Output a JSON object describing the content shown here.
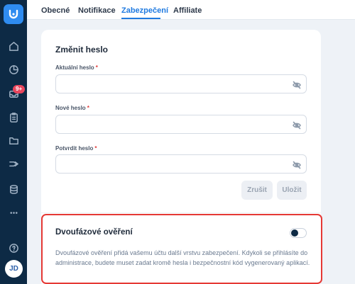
{
  "tabs": [
    {
      "label": "Obecné"
    },
    {
      "label": "Notifikace"
    },
    {
      "label": "Zabezpečení"
    },
    {
      "label": "Affiliate"
    }
  ],
  "active_tab": "Zabezpečení",
  "sidebar": {
    "badge": "9+",
    "avatar_initials": "JD",
    "icons": [
      "home-icon",
      "chart-icon",
      "inbox-icon",
      "clipboard-icon",
      "folder-icon",
      "flow-icon",
      "database-icon",
      "more-icon",
      "help-icon"
    ]
  },
  "password_form": {
    "title": "Změnit heslo",
    "fields": [
      {
        "label": "Aktuální heslo",
        "required": "*",
        "value": ""
      },
      {
        "label": "Nové heslo",
        "required": "*",
        "value": ""
      },
      {
        "label": "Potvrdit heslo",
        "required": "*",
        "value": ""
      }
    ],
    "cancel_label": "Zrušit",
    "save_label": "Uložit"
  },
  "two_factor": {
    "title": "Dvoufázové ověření",
    "enabled": false,
    "description": "Dvoufázové ověření přidá vašemu účtu další vrstvu zabezpečení. Kdykoli se přihlásíte do administrace, budete muset zadat kromě hesla i bezpečnostní kód vygenerovaný aplikací."
  },
  "colors": {
    "sidebar": "#0d2a45",
    "accent": "#1f7ae0",
    "highlight": "#e53935",
    "badge": "#e8465d"
  }
}
